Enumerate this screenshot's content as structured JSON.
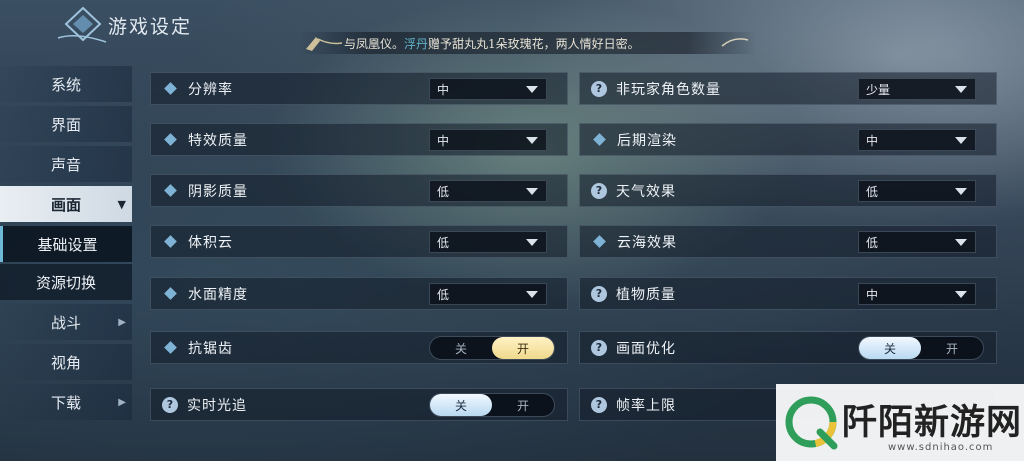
{
  "header": {
    "title": "游戏设定",
    "ticker": {
      "prefix": "与凤凰仪。",
      "highlight": "浮丹",
      "text": "赠予甜丸丸1朵玫瑰花，两人情好日密。"
    }
  },
  "sidebar": {
    "items": [
      {
        "label": "系统"
      },
      {
        "label": "界面"
      },
      {
        "label": "声音"
      },
      {
        "label": "画面",
        "arrow": "▼"
      },
      {
        "label": "基础设置"
      },
      {
        "label": "资源切换"
      },
      {
        "label": "战斗",
        "arrow": "▶"
      },
      {
        "label": "视角"
      },
      {
        "label": "下载",
        "arrow": "▶"
      }
    ]
  },
  "settings": {
    "left": [
      {
        "label": "分辨率",
        "value": "中"
      },
      {
        "label": "特效质量",
        "value": "中"
      },
      {
        "label": "阴影质量",
        "value": "低"
      },
      {
        "label": "体积云",
        "value": "低"
      },
      {
        "label": "水面精度",
        "value": "低"
      },
      {
        "label": "抗锯齿",
        "off": "关",
        "on": "开"
      },
      {
        "label": "实时光追",
        "off": "关",
        "on": "开"
      }
    ],
    "right": [
      {
        "label": "非玩家角色数量",
        "value": "少量"
      },
      {
        "label": "后期渲染",
        "value": "中"
      },
      {
        "label": "天气效果",
        "value": "低"
      },
      {
        "label": "云海效果",
        "value": "低"
      },
      {
        "label": "植物质量",
        "value": "中"
      },
      {
        "label": "画面优化",
        "off": "关",
        "on": "开"
      },
      {
        "label": "帧率上限"
      }
    ],
    "help_glyph": "?"
  },
  "watermark": {
    "title": "阡陌新游网",
    "url": "www.sdnihao.com"
  },
  "colors": {
    "accent_blue": "#7fb3d6",
    "toggle_gold": "#f0d98c",
    "toggle_blue": "#b9d9f1"
  }
}
